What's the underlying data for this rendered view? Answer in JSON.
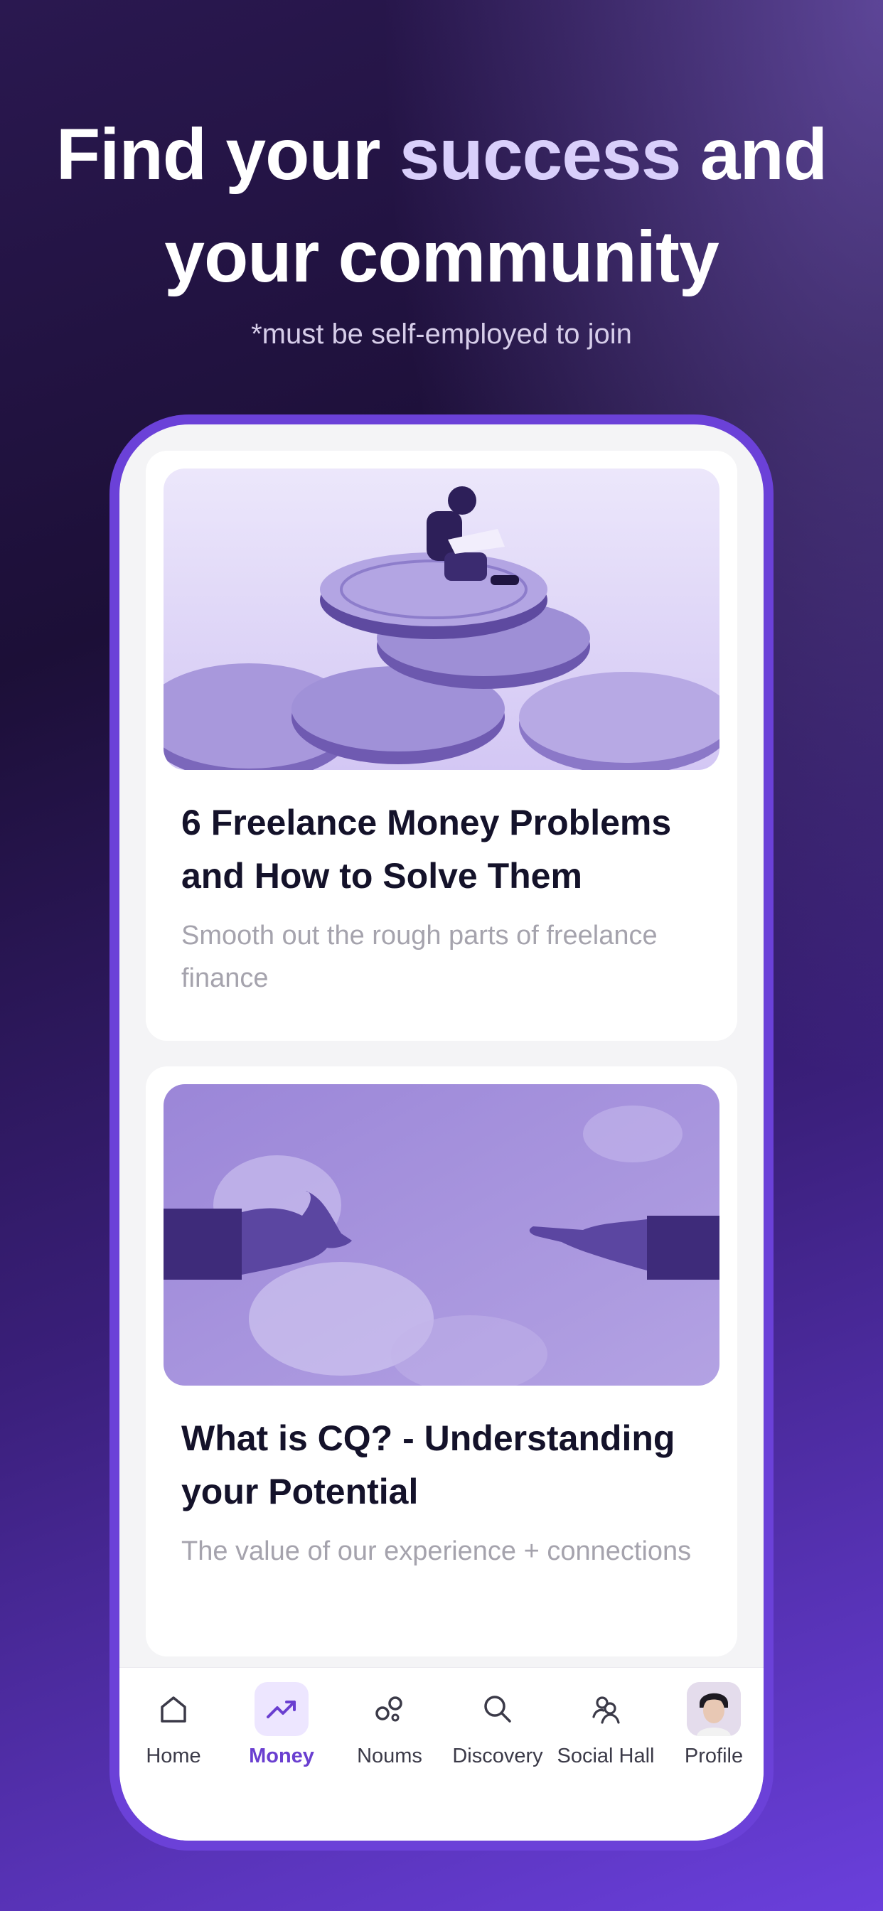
{
  "headline": {
    "part1": "Find your ",
    "accent": "success",
    "part2": " and your community"
  },
  "subline": "*must be self-employed to join",
  "articles": [
    {
      "title": "6 Freelance Money Problems and How to Solve Them",
      "description": "Smooth out the rough parts of freelance finance",
      "image": "coins-stack-with-reader-illustration"
    },
    {
      "title": "What is CQ? - Understanding your Potential",
      "description": "The value of our experience + connections",
      "image": "reaching-hands-sky-illustration"
    }
  ],
  "tabbar": {
    "active": "Money",
    "tabs": [
      {
        "label": "Home",
        "icon": "home-icon"
      },
      {
        "label": "Money",
        "icon": "trending-up-icon"
      },
      {
        "label": "Noums",
        "icon": "bubbles-icon"
      },
      {
        "label": "Discovery",
        "icon": "search-icon"
      },
      {
        "label": "Social Hall",
        "icon": "people-icon"
      },
      {
        "label": "Profile",
        "icon": "avatar"
      }
    ]
  },
  "colors": {
    "accent": "#6b41d8",
    "headline_accent": "#d9cffb",
    "active_tab_bg": "#ede6ff"
  }
}
